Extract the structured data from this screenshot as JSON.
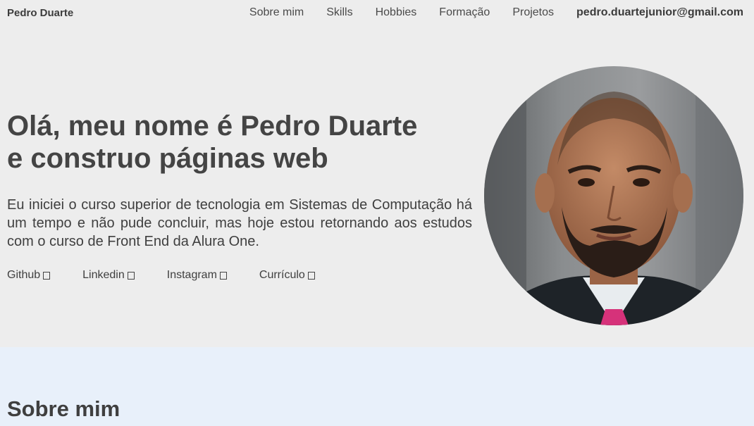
{
  "nav": {
    "brand": "Pedro Duarte",
    "items": [
      {
        "label": "Sobre mim"
      },
      {
        "label": "Skills"
      },
      {
        "label": "Hobbies"
      },
      {
        "label": "Formação"
      },
      {
        "label": "Projetos"
      }
    ],
    "email": "pedro.duartejunior@gmail.com"
  },
  "hero": {
    "title_line1": "Olá, meu nome é Pedro Duarte",
    "title_line2": "e construo páginas web",
    "description": "Eu iniciei o curso superior de tecnologia em Sistemas de Computação há um tempo e não pude concluir, mas hoje estou retornando aos estudos com o curso de Front End da Alura One.",
    "links": [
      {
        "label": "Github"
      },
      {
        "label": "Linkedin"
      },
      {
        "label": "Instagram"
      },
      {
        "label": "Currículo"
      }
    ]
  },
  "about": {
    "title": "Sobre mim"
  },
  "colors": {
    "hero_bg": "#ededed",
    "about_bg": "#e8f0fa",
    "text": "#444444"
  }
}
